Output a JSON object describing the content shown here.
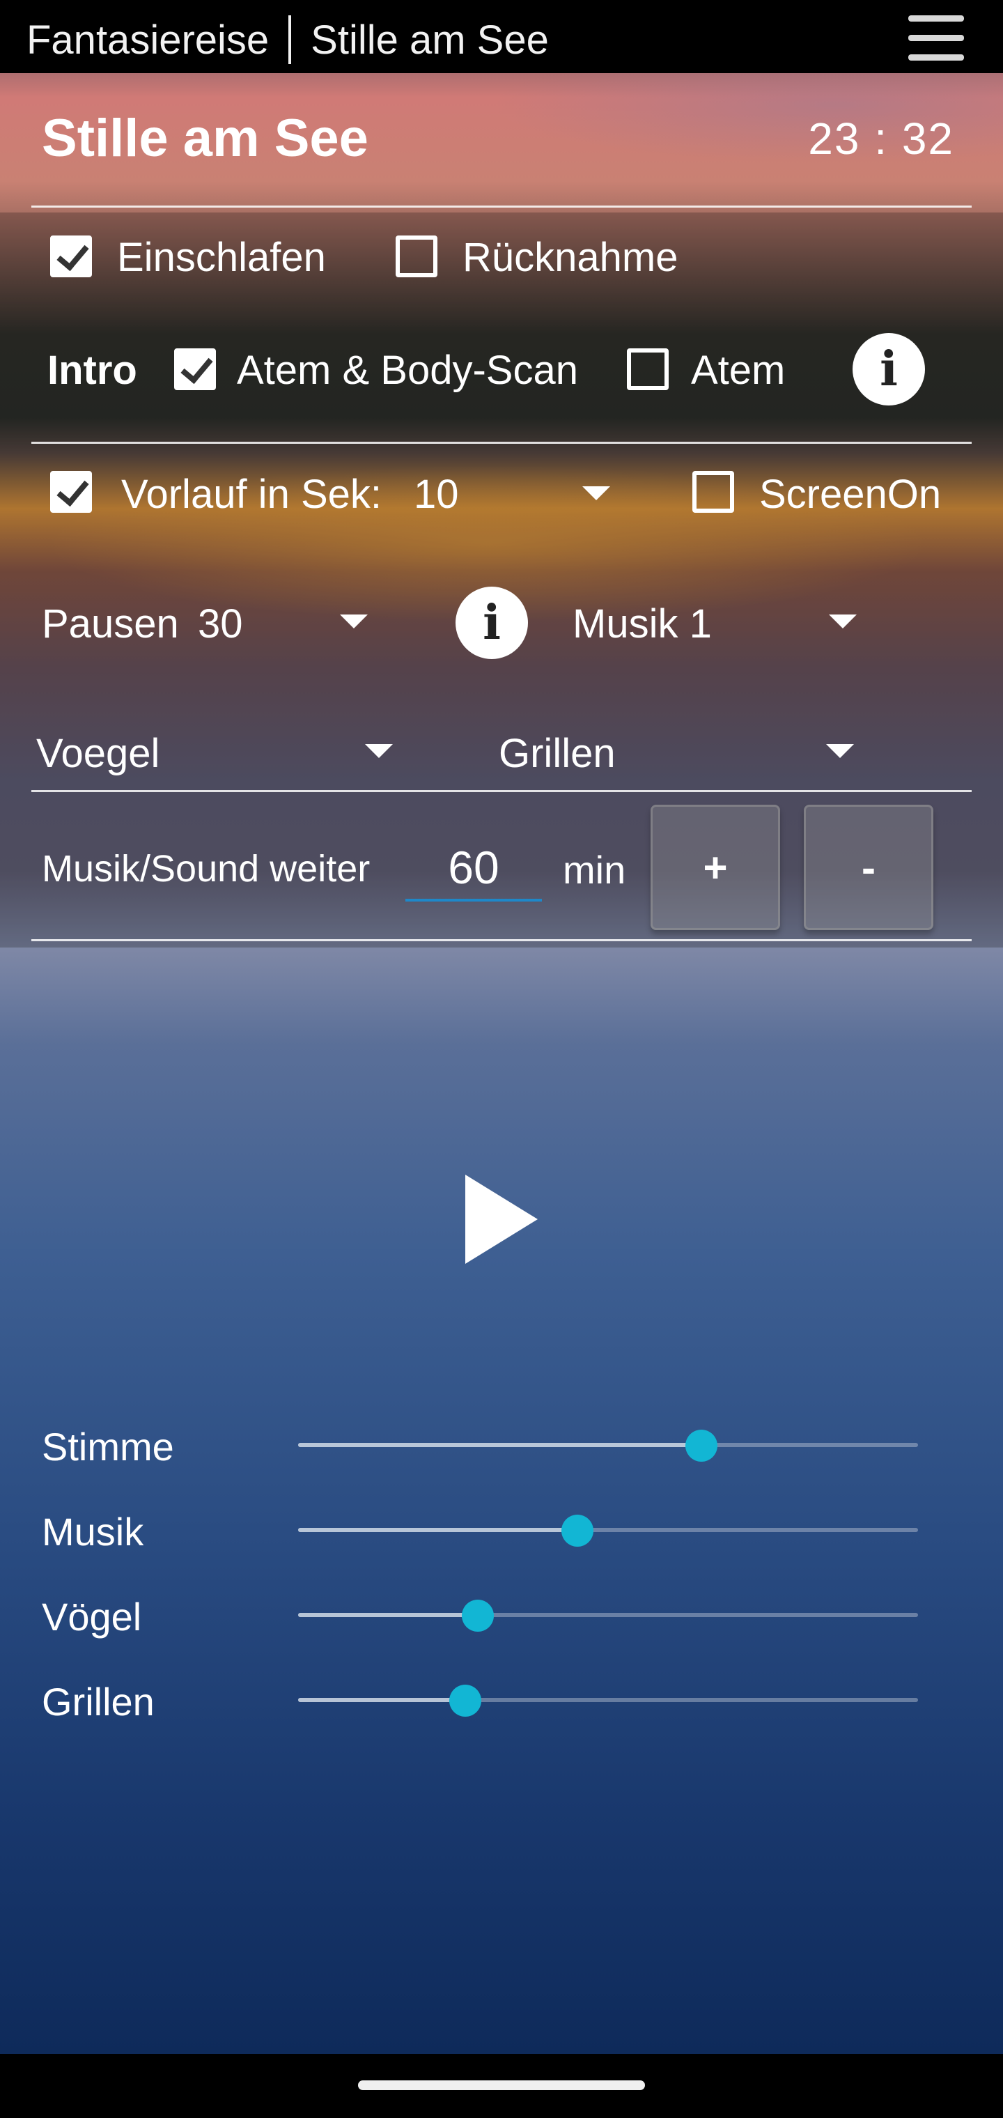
{
  "statusbar": {
    "app_name": "Fantasiereise",
    "screen_name": "Stille am See"
  },
  "header": {
    "title": "Stille am See",
    "time": "23 : 32"
  },
  "options": {
    "einschlafen": {
      "label": "Einschlafen",
      "checked": true
    },
    "ruecknahme": {
      "label": "Rücknahme",
      "checked": false
    }
  },
  "intro": {
    "label": "Intro",
    "atem_body_scan": {
      "label": "Atem & Body-Scan",
      "checked": true
    },
    "atem": {
      "label": "Atem",
      "checked": false
    },
    "info_glyph": "i"
  },
  "vorlauf": {
    "checkbox_checked": true,
    "label": "Vorlauf in Sek:",
    "value": "10"
  },
  "screen_on": {
    "label": "ScreenOn",
    "checked": false
  },
  "pausen": {
    "label": "Pausen",
    "value": "30",
    "info_glyph": "i"
  },
  "musik_select": {
    "value": "Musik 1"
  },
  "sound1_select": {
    "value": "Voegel"
  },
  "sound2_select": {
    "value": "Grillen"
  },
  "continue": {
    "label": "Musik/Sound weiter",
    "value": "60",
    "unit": "min",
    "plus_label": "+",
    "minus_label": "-"
  },
  "volumes": [
    {
      "label": "Stimme",
      "level": 0.65
    },
    {
      "label": "Musik",
      "level": 0.45
    },
    {
      "label": "Vögel",
      "level": 0.29
    },
    {
      "label": "Grillen",
      "level": 0.27
    }
  ],
  "colors": {
    "slider_thumb": "#12b6d4",
    "input_underline": "#1e88c9"
  },
  "icons": {
    "menu": "hamburger-menu-icon",
    "info": "info-icon",
    "play": "play-icon",
    "dropdown": "chevron-down-icon"
  }
}
